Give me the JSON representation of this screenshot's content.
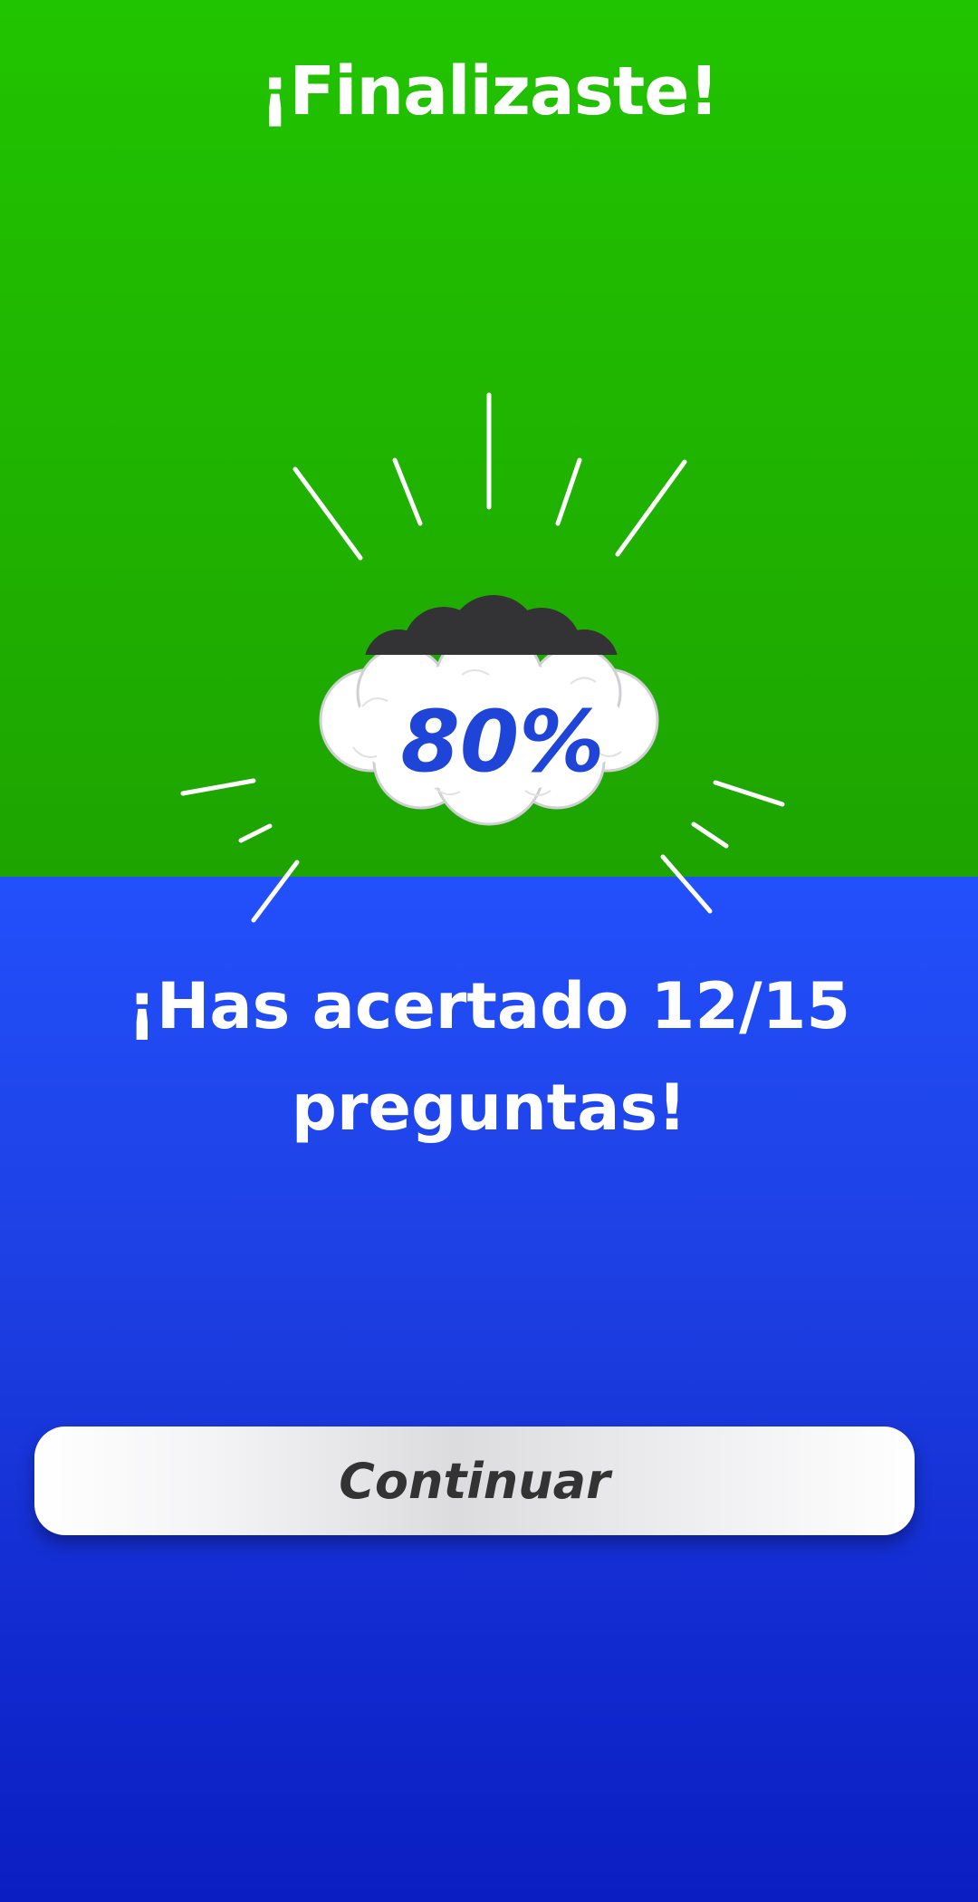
{
  "header": {
    "title": "¡Finalizaste!"
  },
  "result": {
    "percentage": "80%",
    "message": "¡Has acertado 12/15 preguntas!",
    "correct": 12,
    "total": 15
  },
  "actions": {
    "continue_label": "Continuar"
  },
  "colors": {
    "top_background": "#21c400",
    "bottom_background": "#2250fb",
    "score_text": "#1f45d8",
    "button_text": "#333333"
  },
  "icons": {
    "cloud": "cloud-icon",
    "rays": "sunburst-rays"
  }
}
